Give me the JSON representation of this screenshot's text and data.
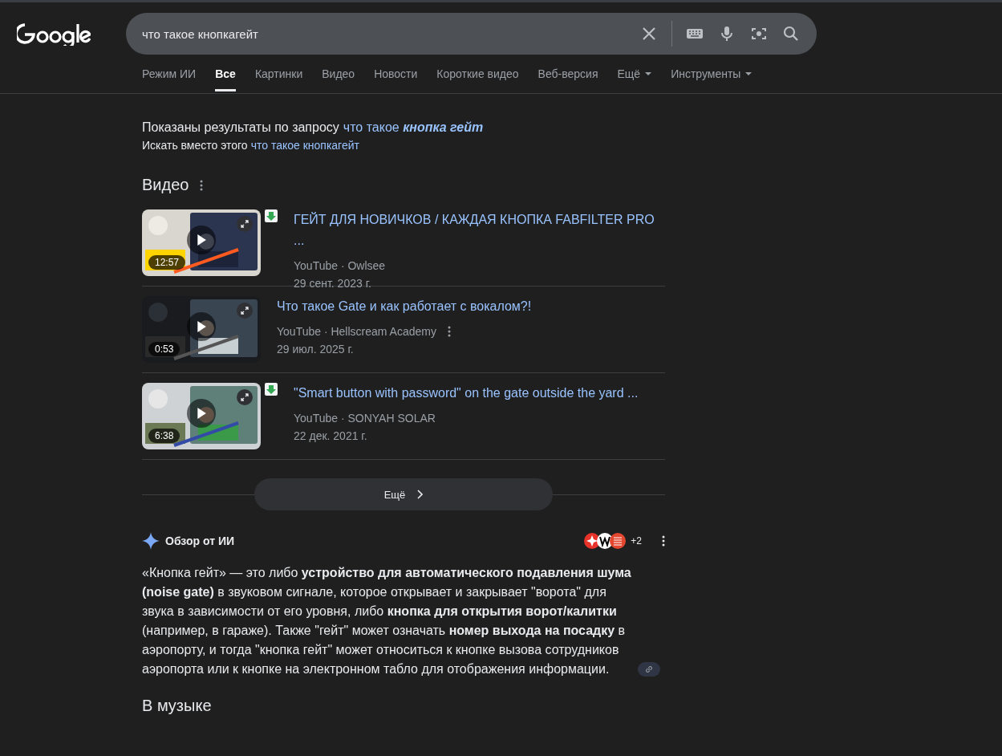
{
  "search": {
    "value": "что такое кнопкагейт"
  },
  "tabs": [
    {
      "label": "Режим ИИ",
      "selected": false,
      "dropdown": false
    },
    {
      "label": "Все",
      "selected": true,
      "dropdown": false
    },
    {
      "label": "Картинки",
      "selected": false,
      "dropdown": false
    },
    {
      "label": "Видео",
      "selected": false,
      "dropdown": false
    },
    {
      "label": "Новости",
      "selected": false,
      "dropdown": false
    },
    {
      "label": "Короткие видео",
      "selected": false,
      "dropdown": false
    },
    {
      "label": "Веб-версия",
      "selected": false,
      "dropdown": false
    },
    {
      "label": "Ещё",
      "selected": false,
      "dropdown": true
    },
    {
      "label": "Инструменты",
      "selected": false,
      "dropdown": true
    }
  ],
  "correction": {
    "shown_prefix": "Показаны результаты по запросу",
    "shown_link": "что такое *кнопка гейт*",
    "instead_prefix": "Искать вместо этого",
    "instead_link": "что такое кнопкагейт"
  },
  "videos_section": {
    "heading": "Видео",
    "more_button": "Ещё",
    "videos": [
      {
        "title": "ГЕЙТ ДЛЯ НОВИЧКОВ / КАЖДАЯ КНОПКА FABFILTER PRO ...",
        "source": "YouTube · Owlsee",
        "date": "29 сент. 2023 г.",
        "duration": "12:57",
        "download_badge": true,
        "menu": false
      },
      {
        "title": "Что такое Gate и как работает с вокалом?!",
        "source": "YouTube · Hellscream Academy",
        "date": "29 июл. 2025 г.",
        "duration": "0:53",
        "download_badge": false,
        "menu": true
      },
      {
        "title": "\"Smart button with password\" on the gate outside the yard ...",
        "source": "YouTube · SONYAH SOLAR",
        "date": "22 дек. 2021 г.",
        "duration": "6:38",
        "download_badge": true,
        "menu": false
      }
    ]
  },
  "ai_overview": {
    "title": "Обзор от ИИ",
    "sources_more": "+2",
    "text": "«Кнопка гейт» — это либо **устройство для автоматического подавления шума (noise gate)** в звуковом сигнале, которое открывает и закрывает \"ворота\" для звука в зависимости от его уровня, либо **кнопка для открытия ворот/калитки** (например, в гараже). Также \"гейт\" может означать **номер выхода на посадку** в аэропорту, и тогда \"кнопка гейт\" может относиться к кнопке вызова сотрудников аэропорта или к кнопке на электронном табло для отображения информации.",
    "next_heading": "В музыке"
  }
}
